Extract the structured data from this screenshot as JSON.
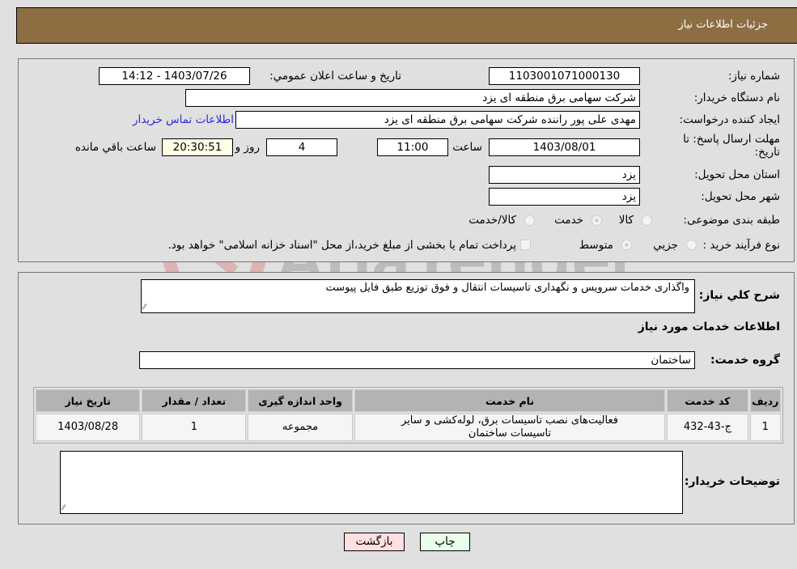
{
  "header": {
    "title": "جزئیات اطلاعات نیاز"
  },
  "details": {
    "need_number_label": "شماره نیاز:",
    "need_number": "1103001071000130",
    "announce_label": "تاریخ و ساعت اعلان عمومي:",
    "announce_value": "1403/07/26 - 14:12",
    "buyer_org_label": "نام دستگاه خریدار:",
    "buyer_org": "شرکت سهامی برق منطقه ای یزد",
    "creator_label": "ایجاد کننده درخواست:",
    "creator": "مهدی علی پور راننده شرکت سهامی برق منطقه ای یزد",
    "contact_link": "اطلاعات تماس خریدار",
    "deadline_label": "مهلت ارسال پاسخ: تا تاریخ:",
    "deadline_date": "1403/08/01",
    "time_label": "ساعت",
    "deadline_time": "11:00",
    "days": "4",
    "days_label": "روز و",
    "remaining_time": "20:30:51",
    "remaining_label": "ساعت باقي مانده",
    "province_label": "استان محل تحویل:",
    "province": "یزد",
    "city_label": "شهر محل تحویل:",
    "city": "یزد",
    "category_label": "طبقه بندی موضوعی:",
    "category_options": [
      "کالا",
      "خدمت",
      "کالا/خدمت"
    ],
    "category_selected": "خدمت",
    "process_label": "نوع فرآیند خرید :",
    "process_options": [
      "جزیي",
      "متوسط"
    ],
    "process_selected": "متوسط",
    "treasury_note": "پرداخت تمام یا بخشی از مبلغ خرید،از محل \"اسناد خزانه اسلامی\" خواهد بود."
  },
  "description": {
    "label": "شرح کلي نیاز:",
    "value": "واگذاری خدمات سرویس و نگهداری تاسیسات انتقال و فوق توزیع طبق فایل پیوست"
  },
  "services": {
    "section_title": "اطلاعات خدمات مورد نیاز",
    "group_label": "گروه خدمت:",
    "group_value": "ساختمان",
    "columns": [
      "ردیف",
      "کد خدمت",
      "نام خدمت",
      "واحد اندازه گیری",
      "تعداد / مقدار",
      "تاریخ نیاز"
    ],
    "rows": [
      [
        "1",
        "ج-43-432",
        "فعالیت‌های نصب تاسیسات برق، لوله‌کشی و سایر تاسیسات ساختمان",
        "مجموعه",
        "1",
        "1403/08/28"
      ]
    ]
  },
  "buyer_notes": {
    "label": "توضیحات خریدار:",
    "value": ""
  },
  "buttons": {
    "print": "چاپ",
    "back": "بازگشت"
  },
  "watermark": {
    "text": "AriaTender.neT"
  }
}
